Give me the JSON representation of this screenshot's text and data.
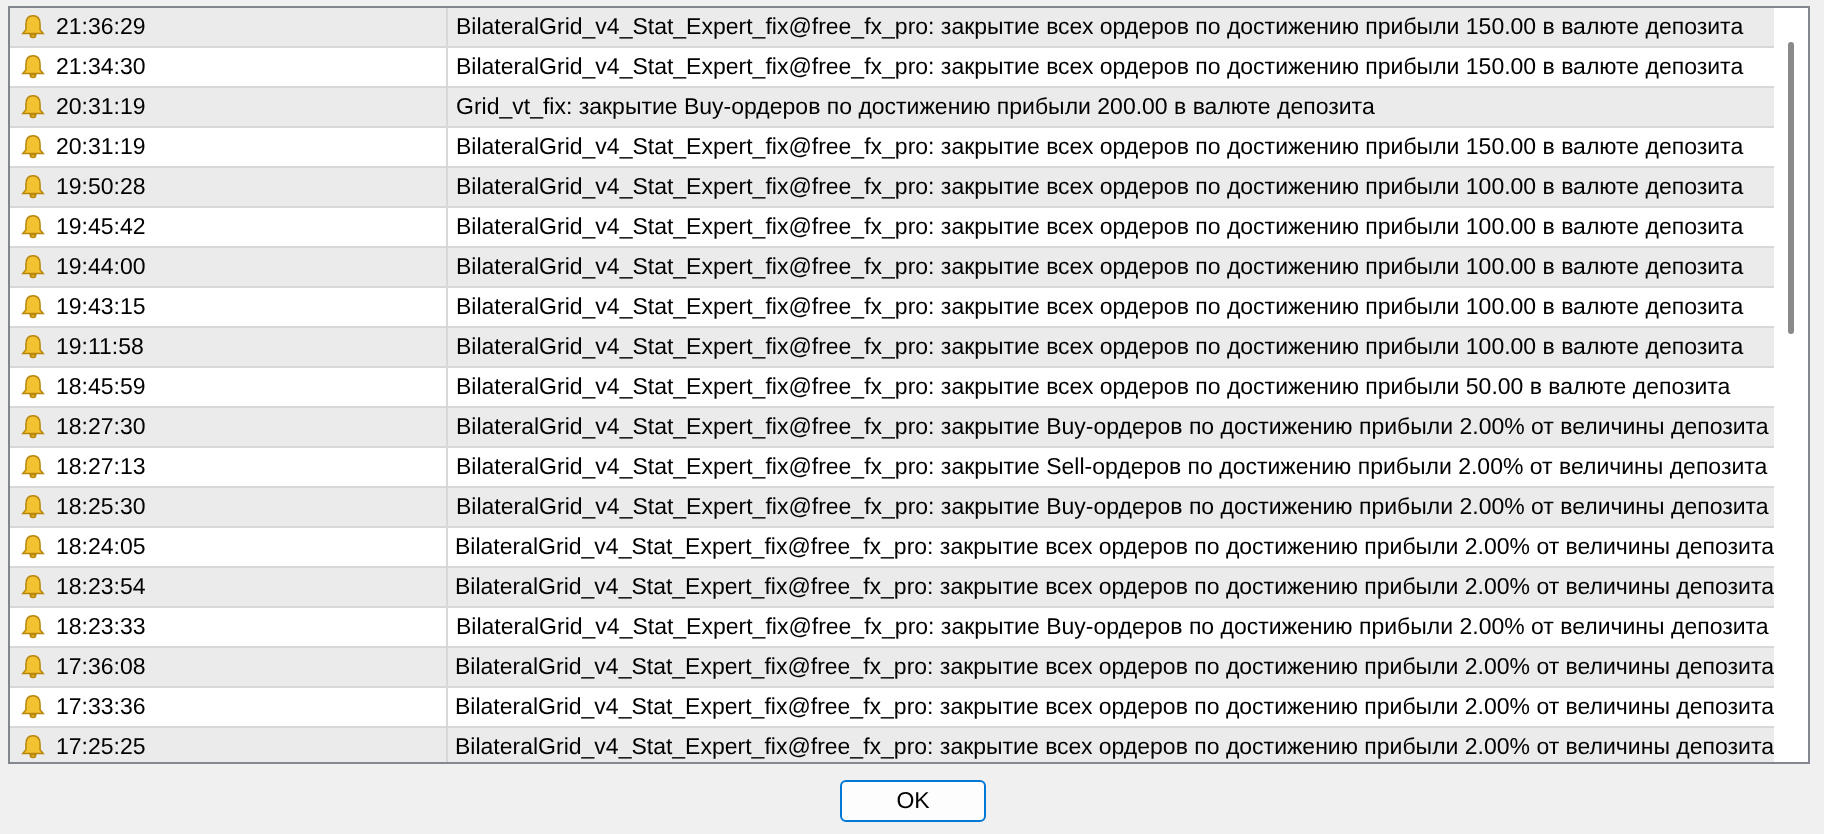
{
  "journal": {
    "rows": [
      {
        "time": "21:36:29",
        "message": "BilateralGrid_v4_Stat_Expert_fix@free_fx_pro: закрытие всех ордеров по достижению прибыли 150.00 в валюте депозита"
      },
      {
        "time": "21:34:30",
        "message": "BilateralGrid_v4_Stat_Expert_fix@free_fx_pro: закрытие всех ордеров по достижению прибыли 150.00 в валюте депозита"
      },
      {
        "time": "20:31:19",
        "message": "Grid_vt_fix: закрытие Buy-ордеров по достижению прибыли 200.00 в валюте депозита"
      },
      {
        "time": "20:31:19",
        "message": "BilateralGrid_v4_Stat_Expert_fix@free_fx_pro: закрытие всех ордеров по достижению прибыли 150.00 в валюте депозита"
      },
      {
        "time": "19:50:28",
        "message": "BilateralGrid_v4_Stat_Expert_fix@free_fx_pro: закрытие всех ордеров по достижению прибыли 100.00 в валюте депозита"
      },
      {
        "time": "19:45:42",
        "message": "BilateralGrid_v4_Stat_Expert_fix@free_fx_pro: закрытие всех ордеров по достижению прибыли 100.00 в валюте депозита"
      },
      {
        "time": "19:44:00",
        "message": "BilateralGrid_v4_Stat_Expert_fix@free_fx_pro: закрытие всех ордеров по достижению прибыли 100.00 в валюте депозита"
      },
      {
        "time": "19:43:15",
        "message": "BilateralGrid_v4_Stat_Expert_fix@free_fx_pro: закрытие всех ордеров по достижению прибыли 100.00 в валюте депозита"
      },
      {
        "time": "19:11:58",
        "message": "BilateralGrid_v4_Stat_Expert_fix@free_fx_pro: закрытие всех ордеров по достижению прибыли 100.00 в валюте депозита"
      },
      {
        "time": "18:45:59",
        "message": "BilateralGrid_v4_Stat_Expert_fix@free_fx_pro: закрытие всех ордеров по достижению прибыли 50.00 в валюте депозита"
      },
      {
        "time": "18:27:30",
        "message": "BilateralGrid_v4_Stat_Expert_fix@free_fx_pro: закрытие Buy-ордеров по достижению прибыли 2.00% от величины депозита"
      },
      {
        "time": "18:27:13",
        "message": "BilateralGrid_v4_Stat_Expert_fix@free_fx_pro: закрытие Sell-ордеров по достижению прибыли 2.00% от величины депозита"
      },
      {
        "time": "18:25:30",
        "message": "BilateralGrid_v4_Stat_Expert_fix@free_fx_pro: закрытие Buy-ордеров по достижению прибыли 2.00% от величины депозита"
      },
      {
        "time": "18:24:05",
        "message": "BilateralGrid_v4_Stat_Expert_fix@free_fx_pro: закрытие всех ордеров по достижению прибыли 2.00% от величины депозита"
      },
      {
        "time": "18:23:54",
        "message": "BilateralGrid_v4_Stat_Expert_fix@free_fx_pro: закрытие всех ордеров по достижению прибыли 2.00% от величины депозита"
      },
      {
        "time": "18:23:33",
        "message": "BilateralGrid_v4_Stat_Expert_fix@free_fx_pro: закрытие Buy-ордеров по достижению прибыли 2.00% от величины депозита"
      },
      {
        "time": "17:36:08",
        "message": "BilateralGrid_v4_Stat_Expert_fix@free_fx_pro: закрытие всех ордеров по достижению прибыли 2.00% от величины депозита"
      },
      {
        "time": "17:33:36",
        "message": "BilateralGrid_v4_Stat_Expert_fix@free_fx_pro: закрытие всех ордеров по достижению прибыли 2.00% от величины депозита"
      },
      {
        "time": "17:25:25",
        "message": "BilateralGrid_v4_Stat_Expert_fix@free_fx_pro: закрытие всех ордеров по достижению прибыли 2.00% от величины депозита"
      }
    ]
  },
  "buttons": [
    "OK"
  ]
}
